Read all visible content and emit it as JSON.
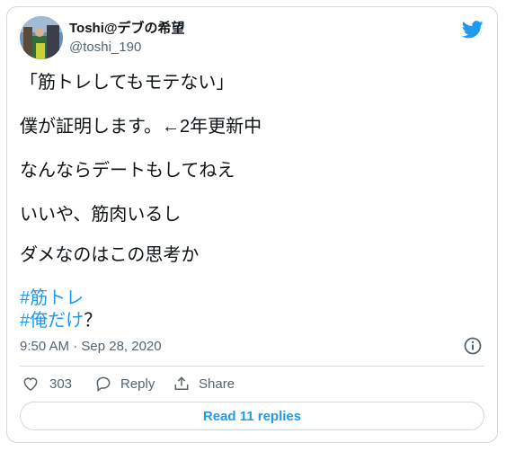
{
  "author": {
    "display_name": "Toshi@デブの希望",
    "handle": "@toshi_190"
  },
  "tweet": {
    "lines": [
      "「筋トレしてもモテない」",
      "僕が証明します。←2年更新中",
      "なんならデートもしてねえ",
      "いいや、筋肉いるし",
      "ダメなのはこの思考か"
    ],
    "hashtag_1": "#筋トレ",
    "hashtag_2": "#俺だけ",
    "hashtag_2_suffix": "？",
    "timestamp": "9:50 AM · Sep 28, 2020"
  },
  "actions": {
    "likes": "303",
    "reply_label": "Reply",
    "share_label": "Share"
  },
  "read_replies_label": "Read 11 replies",
  "colors": {
    "accent": "#1d9bf0",
    "secondary_text": "#536471",
    "border": "#cfd9de"
  },
  "icons": [
    "twitter-logo-icon",
    "info-icon",
    "heart-icon",
    "reply-icon",
    "share-icon"
  ]
}
